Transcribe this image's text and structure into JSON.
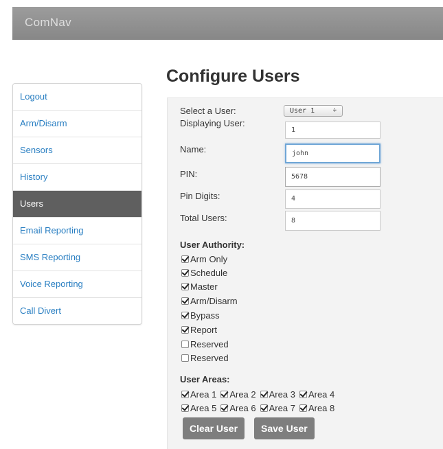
{
  "app": {
    "brand": "ComNav"
  },
  "sidebar": {
    "items": [
      {
        "label": "Logout"
      },
      {
        "label": "Arm/Disarm"
      },
      {
        "label": "Sensors"
      },
      {
        "label": "History"
      },
      {
        "label": "Users",
        "active": true
      },
      {
        "label": "Email Reporting"
      },
      {
        "label": "SMS Reporting"
      },
      {
        "label": "Voice Reporting"
      },
      {
        "label": "Call Divert"
      }
    ]
  },
  "page": {
    "title": "Configure Users"
  },
  "form": {
    "select_user_label": "Select a User:",
    "select_user_value": "User 1",
    "select_user_arrows": "÷",
    "displaying_user_label": "Displaying User:",
    "displaying_user_value": "1",
    "name_label": "Name:",
    "name_value": "john",
    "pin_label": "PIN:",
    "pin_value": "5678",
    "pin_digits_label": "Pin Digits:",
    "pin_digits_value": "4",
    "total_users_label": "Total Users:",
    "total_users_value": "8"
  },
  "authority": {
    "title": "User Authority:",
    "items": [
      {
        "label": "Arm Only",
        "checked": true
      },
      {
        "label": "Schedule",
        "checked": true
      },
      {
        "label": "Master",
        "checked": true
      },
      {
        "label": "Arm/Disarm",
        "checked": true
      },
      {
        "label": "Bypass",
        "checked": true
      },
      {
        "label": "Report",
        "checked": true
      },
      {
        "label": "Reserved",
        "checked": false
      },
      {
        "label": "Reserved",
        "checked": false
      }
    ]
  },
  "areas": {
    "title": "User Areas:",
    "items": [
      {
        "label": "Area 1",
        "checked": true
      },
      {
        "label": "Area 2",
        "checked": true
      },
      {
        "label": "Area 3",
        "checked": true
      },
      {
        "label": "Area 4",
        "checked": true
      },
      {
        "label": "Area 5",
        "checked": true
      },
      {
        "label": "Area 6",
        "checked": true
      },
      {
        "label": "Area 7",
        "checked": true
      },
      {
        "label": "Area 8",
        "checked": true
      }
    ]
  },
  "buttons": {
    "clear": "Clear User",
    "save": "Save User"
  }
}
